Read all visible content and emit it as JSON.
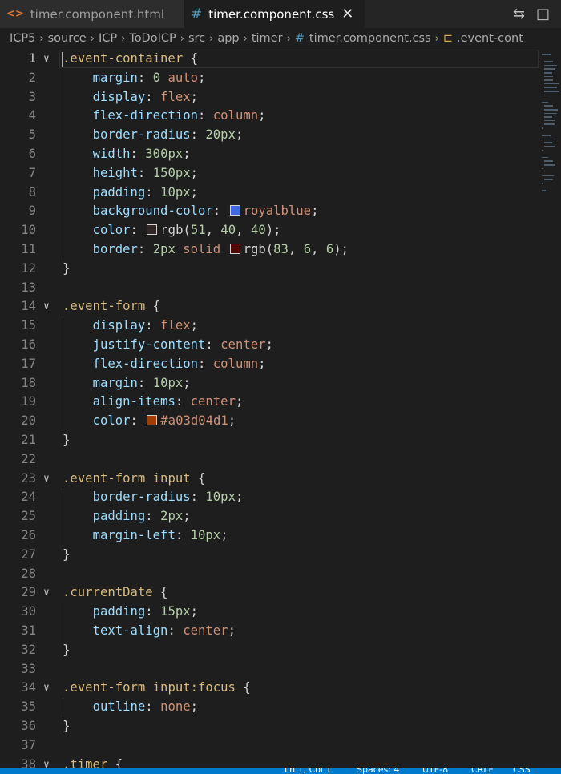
{
  "tabs": [
    {
      "label": "timer.component.html",
      "icon": "<>",
      "active": false
    },
    {
      "label": "timer.component.css",
      "icon": "#",
      "active": true,
      "close": "✕"
    }
  ],
  "tab_actions": [
    {
      "icon": "compare-changes-icon",
      "glyph": "⇆"
    },
    {
      "icon": "split-editor-icon",
      "glyph": "◫"
    }
  ],
  "breadcrumb": {
    "items": [
      "ICP5",
      "source",
      "ICP",
      "ToDoICP",
      "src",
      "app",
      "timer"
    ],
    "file": "timer.component.css",
    "symbol": ".event-cont"
  },
  "editor": {
    "cursor_line": 1,
    "lines": [
      {
        "n": "1",
        "fold": true,
        "t": [
          [
            ".event-container",
            "sel"
          ],
          [
            " {",
            "punc"
          ]
        ]
      },
      {
        "n": "2",
        "t": [
          [
            "    "
          ],
          [
            "margin",
            "prop"
          ],
          [
            ": "
          ],
          [
            "0",
            "num"
          ],
          [
            " "
          ],
          [
            "auto",
            "val"
          ],
          [
            ";"
          ]
        ]
      },
      {
        "n": "3",
        "t": [
          [
            "    "
          ],
          [
            "display",
            "prop"
          ],
          [
            ": "
          ],
          [
            "flex",
            "val"
          ],
          [
            ";"
          ]
        ]
      },
      {
        "n": "4",
        "t": [
          [
            "    "
          ],
          [
            "flex-direction",
            "prop"
          ],
          [
            ": "
          ],
          [
            "column",
            "val"
          ],
          [
            ";"
          ]
        ]
      },
      {
        "n": "5",
        "t": [
          [
            "    "
          ],
          [
            "border-radius",
            "prop"
          ],
          [
            ": "
          ],
          [
            "20px",
            "num"
          ],
          [
            ";"
          ]
        ]
      },
      {
        "n": "6",
        "t": [
          [
            "    "
          ],
          [
            "width",
            "prop"
          ],
          [
            ": "
          ],
          [
            "300px",
            "num"
          ],
          [
            ";"
          ]
        ]
      },
      {
        "n": "7",
        "t": [
          [
            "    "
          ],
          [
            "height",
            "prop"
          ],
          [
            ": "
          ],
          [
            "150px",
            "num"
          ],
          [
            ";"
          ]
        ]
      },
      {
        "n": "8",
        "t": [
          [
            "    "
          ],
          [
            "padding",
            "prop"
          ],
          [
            ": "
          ],
          [
            "10px",
            "num"
          ],
          [
            ";"
          ]
        ]
      },
      {
        "n": "9",
        "t": [
          [
            "    "
          ],
          [
            "background-color",
            "prop"
          ],
          [
            ": "
          ],
          [
            "#4169e1",
            "swatch"
          ],
          [
            "royalblue",
            "val"
          ],
          [
            ";"
          ]
        ]
      },
      {
        "n": "10",
        "t": [
          [
            "    "
          ],
          [
            "color",
            "prop"
          ],
          [
            ": "
          ],
          [
            "#332828",
            "swatch"
          ],
          [
            "rgb("
          ],
          [
            "51",
            "num"
          ],
          [
            ", "
          ],
          [
            "40",
            "num"
          ],
          [
            ", "
          ],
          [
            "40",
            "num"
          ],
          [
            ");"
          ]
        ]
      },
      {
        "n": "11",
        "t": [
          [
            "    "
          ],
          [
            "border",
            "prop"
          ],
          [
            ": "
          ],
          [
            "2px",
            "num"
          ],
          [
            " "
          ],
          [
            "solid",
            "val"
          ],
          [
            " "
          ],
          [
            "#530606",
            "swatch"
          ],
          [
            "rgb("
          ],
          [
            "83",
            "num"
          ],
          [
            ", "
          ],
          [
            "6",
            "num"
          ],
          [
            ", "
          ],
          [
            "6",
            "num"
          ],
          [
            ");"
          ]
        ]
      },
      {
        "n": "12",
        "t": [
          [
            "}"
          ]
        ]
      },
      {
        "n": "13",
        "t": []
      },
      {
        "n": "14",
        "fold": true,
        "t": [
          [
            ".event-form",
            "sel"
          ],
          [
            " {"
          ]
        ]
      },
      {
        "n": "15",
        "t": [
          [
            "    "
          ],
          [
            "display",
            "prop"
          ],
          [
            ": "
          ],
          [
            "flex",
            "val"
          ],
          [
            ";"
          ]
        ]
      },
      {
        "n": "16",
        "t": [
          [
            "    "
          ],
          [
            "justify-content",
            "prop"
          ],
          [
            ": "
          ],
          [
            "center",
            "val"
          ],
          [
            ";"
          ]
        ]
      },
      {
        "n": "17",
        "t": [
          [
            "    "
          ],
          [
            "flex-direction",
            "prop"
          ],
          [
            ": "
          ],
          [
            "column",
            "val"
          ],
          [
            ";"
          ]
        ]
      },
      {
        "n": "18",
        "t": [
          [
            "    "
          ],
          [
            "margin",
            "prop"
          ],
          [
            ": "
          ],
          [
            "10px",
            "num"
          ],
          [
            ";"
          ]
        ]
      },
      {
        "n": "19",
        "t": [
          [
            "    "
          ],
          [
            "align-items",
            "prop"
          ],
          [
            ": "
          ],
          [
            "center",
            "val"
          ],
          [
            ";"
          ]
        ]
      },
      {
        "n": "20",
        "t": [
          [
            "    "
          ],
          [
            "color",
            "prop"
          ],
          [
            ": "
          ],
          [
            "#a03d04",
            "swatch"
          ],
          [
            "#a03d04d1",
            "val"
          ],
          [
            ";"
          ]
        ]
      },
      {
        "n": "21",
        "t": [
          [
            "}"
          ]
        ]
      },
      {
        "n": "22",
        "t": []
      },
      {
        "n": "23",
        "fold": true,
        "t": [
          [
            ".event-form",
            "sel"
          ],
          [
            " "
          ],
          [
            "input",
            "sel"
          ],
          [
            " {"
          ]
        ]
      },
      {
        "n": "24",
        "t": [
          [
            "    "
          ],
          [
            "border-radius",
            "prop"
          ],
          [
            ": "
          ],
          [
            "10px",
            "num"
          ],
          [
            ";"
          ]
        ]
      },
      {
        "n": "25",
        "t": [
          [
            "    "
          ],
          [
            "padding",
            "prop"
          ],
          [
            ": "
          ],
          [
            "2px",
            "num"
          ],
          [
            ";"
          ]
        ]
      },
      {
        "n": "26",
        "t": [
          [
            "    "
          ],
          [
            "margin-left",
            "prop"
          ],
          [
            ": "
          ],
          [
            "10px",
            "num"
          ],
          [
            ";"
          ]
        ]
      },
      {
        "n": "27",
        "t": [
          [
            "}"
          ]
        ]
      },
      {
        "n": "28",
        "t": []
      },
      {
        "n": "29",
        "fold": true,
        "t": [
          [
            ".currentDate",
            "sel"
          ],
          [
            " {"
          ]
        ]
      },
      {
        "n": "30",
        "t": [
          [
            "    "
          ],
          [
            "padding",
            "prop"
          ],
          [
            ": "
          ],
          [
            "15px",
            "num"
          ],
          [
            ";"
          ]
        ]
      },
      {
        "n": "31",
        "t": [
          [
            "    "
          ],
          [
            "text-align",
            "prop"
          ],
          [
            ": "
          ],
          [
            "center",
            "val"
          ],
          [
            ";"
          ]
        ]
      },
      {
        "n": "32",
        "t": [
          [
            "}"
          ]
        ]
      },
      {
        "n": "33",
        "t": []
      },
      {
        "n": "34",
        "fold": true,
        "t": [
          [
            ".event-form",
            "sel"
          ],
          [
            " "
          ],
          [
            "input:focus",
            "sel"
          ],
          [
            " {"
          ]
        ]
      },
      {
        "n": "35",
        "t": [
          [
            "    "
          ],
          [
            "outline",
            "prop"
          ],
          [
            ": "
          ],
          [
            "none",
            "val"
          ],
          [
            ";"
          ]
        ]
      },
      {
        "n": "36",
        "t": [
          [
            "}"
          ]
        ]
      },
      {
        "n": "37",
        "t": []
      },
      {
        "n": "38",
        "fold": true,
        "t": [
          [
            ".timer",
            "sel"
          ],
          [
            " {"
          ]
        ]
      }
    ]
  },
  "status": {
    "position": "Ln 1, Col 1",
    "spaces": "Spaces: 4",
    "encoding": "UTF-8",
    "eol": "CRLF",
    "language": "CSS"
  }
}
